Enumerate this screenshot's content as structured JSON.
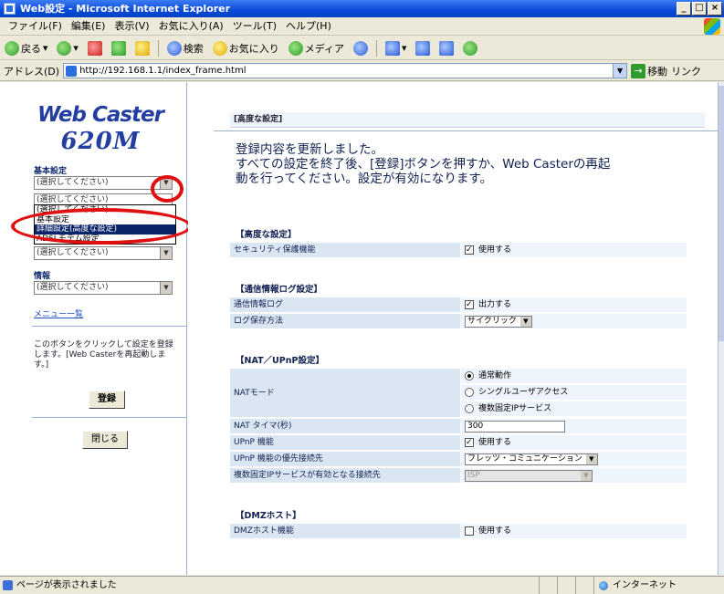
{
  "window": {
    "title": "Web設定 - Microsoft Internet Explorer"
  },
  "menu": [
    "ファイル(F)",
    "編集(E)",
    "表示(V)",
    "お気に入り(A)",
    "ツール(T)",
    "ヘルプ(H)"
  ],
  "toolbar": {
    "back": "戻る",
    "search": "検索",
    "favorites": "お気に入り",
    "media": "メディア"
  },
  "address": {
    "label": "アドレス(D)",
    "url": "http://192.168.1.1/index_frame.html",
    "go": "移動",
    "links": "リンク"
  },
  "left": {
    "logo_line1": "Web Caster",
    "logo_line2": "620M",
    "section_basic": "基本設定",
    "select_placeholder": "(選択してください)",
    "dropdown_options": [
      "(選択してください)",
      "基本設定",
      "詳細設定(高度な設定)",
      "ADSLモデム設定"
    ],
    "dropdown_highlight_index": 2,
    "section_info": "情報",
    "menu_link": "メニュー一覧",
    "help_text": "このボタンをクリックして設定を登録します。[Web Casterを再起動します。]",
    "register_button": "登録",
    "close_button": "閉じる"
  },
  "main": {
    "breadcrumb": "[高度な設定]",
    "message": "登録内容を更新しました。\nすべての設定を終了後、[登録]ボタンを押すか、Web Casterの再起動を行ってください。設定が有効になります。",
    "sections": {
      "advanced": {
        "title": "【高度な設定】",
        "security_label": "セキュリティ保護機能",
        "security_value": "使用する",
        "security_checked": true
      },
      "log": {
        "title": "【通信情報ログ設定】",
        "log_label": "通信情報ログ",
        "log_value": "出力する",
        "log_checked": true,
        "save_label": "ログ保存方法",
        "save_value": "サイクリック"
      },
      "nat": {
        "title": "【NAT／UPnP設定】",
        "mode_label": "NATモード",
        "mode_options": [
          "通常動作",
          "シングルユーザアクセス",
          "複数固定IPサービス"
        ],
        "mode_selected": 0,
        "timer_label": "NAT タイマ(秒)",
        "timer_value": "300",
        "upnp_label": "UPnP 機能",
        "upnp_value": "使用する",
        "upnp_checked": true,
        "upnp_pref_label": "UPnP 機能の優先接続先",
        "upnp_pref_value": "フレッツ・コミュニケーション",
        "multi_ip_label": "複数固定IPサービスが有効となる接続先",
        "multi_ip_value": "ISP"
      },
      "dmz": {
        "title": "【DMZホスト】",
        "dmz_label": "DMZホスト機能",
        "dmz_value": "使用する",
        "dmz_checked": false
      }
    }
  },
  "status": {
    "text": "ページが表示されました",
    "zone": "インターネット"
  },
  "colors": {
    "title_bar": "#0a4ad8",
    "highlight": "#0a246a",
    "annotation": "#e01010"
  }
}
